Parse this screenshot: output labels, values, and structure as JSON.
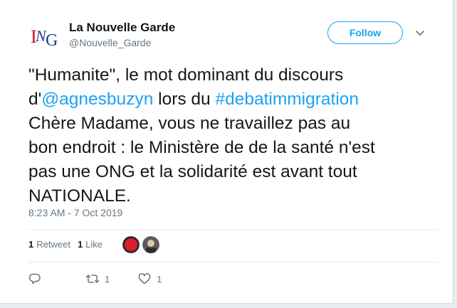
{
  "user": {
    "display_name": "La Nouvelle Garde",
    "handle": "@Nouvelle_Garde",
    "avatar_text": "NG"
  },
  "follow_label": "Follow",
  "tweet": {
    "lines": [
      [
        {
          "text": "\"Humanite\", le mot dominant du discours"
        }
      ],
      [
        {
          "text": "d'"
        },
        {
          "text": "@agnesbuzyn",
          "link": true
        },
        {
          "text": " lors du "
        },
        {
          "text": "#debatimmigration",
          "link": true
        }
      ],
      [
        {
          "text": "Chère Madame, vous ne travaillez pas au"
        }
      ],
      [
        {
          "text": "bon endroit : le Ministère de de la santé n'est"
        }
      ],
      [
        {
          "text": "pas une ONG et la solidarité est avant tout"
        }
      ],
      [
        {
          "text": "NATIONALE."
        }
      ]
    ]
  },
  "timestamp": "8:23 AM - 7 Oct 2019",
  "stats": {
    "retweet_count": "1",
    "retweet_label": "Retweet",
    "like_count": "1",
    "like_label": "Like"
  },
  "actions": {
    "reply_icon": "reply-icon",
    "retweet_count": "1",
    "like_count": "1"
  },
  "colors": {
    "accent": "#1da1f2",
    "text": "#14171a",
    "muted": "#657786",
    "logo_red": "#c8102e",
    "logo_blue": "#1e3a8a"
  }
}
